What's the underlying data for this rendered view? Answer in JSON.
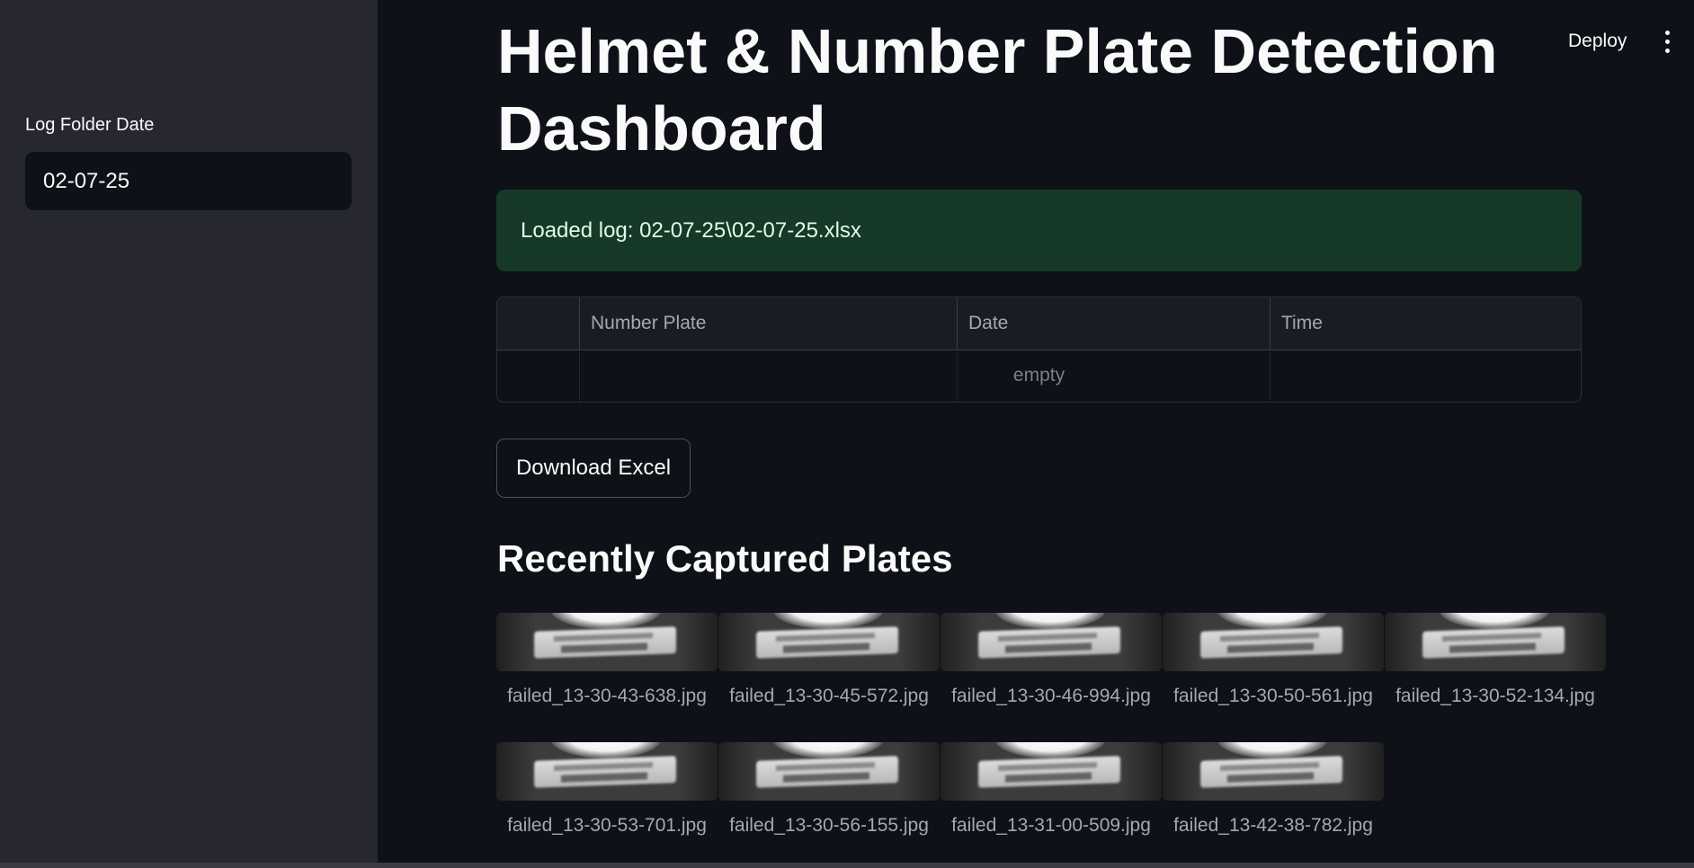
{
  "header": {
    "deploy_label": "Deploy",
    "menu_icon": "vertical-ellipsis-icon"
  },
  "sidebar": {
    "date_label": "Log Folder Date",
    "date_value": "02-07-25"
  },
  "main": {
    "title": "Helmet & Number Plate Detection Dashboard",
    "alert_text": "Loaded log: 02-07-25\\02-07-25.xlsx",
    "table": {
      "columns": [
        "",
        "Number Plate",
        "Date",
        "Time"
      ],
      "empty_text": "empty"
    },
    "download_label": "Download Excel",
    "gallery_title": "Recently Captured Plates",
    "gallery": [
      "failed_13-30-43-638.jpg",
      "failed_13-30-45-572.jpg",
      "failed_13-30-46-994.jpg",
      "failed_13-30-50-561.jpg",
      "failed_13-30-52-134.jpg",
      "failed_13-30-53-701.jpg",
      "failed_13-30-56-155.jpg",
      "failed_13-31-00-509.jpg",
      "failed_13-42-38-782.jpg"
    ]
  },
  "colors": {
    "background": "#0e1117",
    "sidebar": "#262730",
    "success_bg": "#173928",
    "text": "#fafafa",
    "muted": "#a3a8b4"
  }
}
